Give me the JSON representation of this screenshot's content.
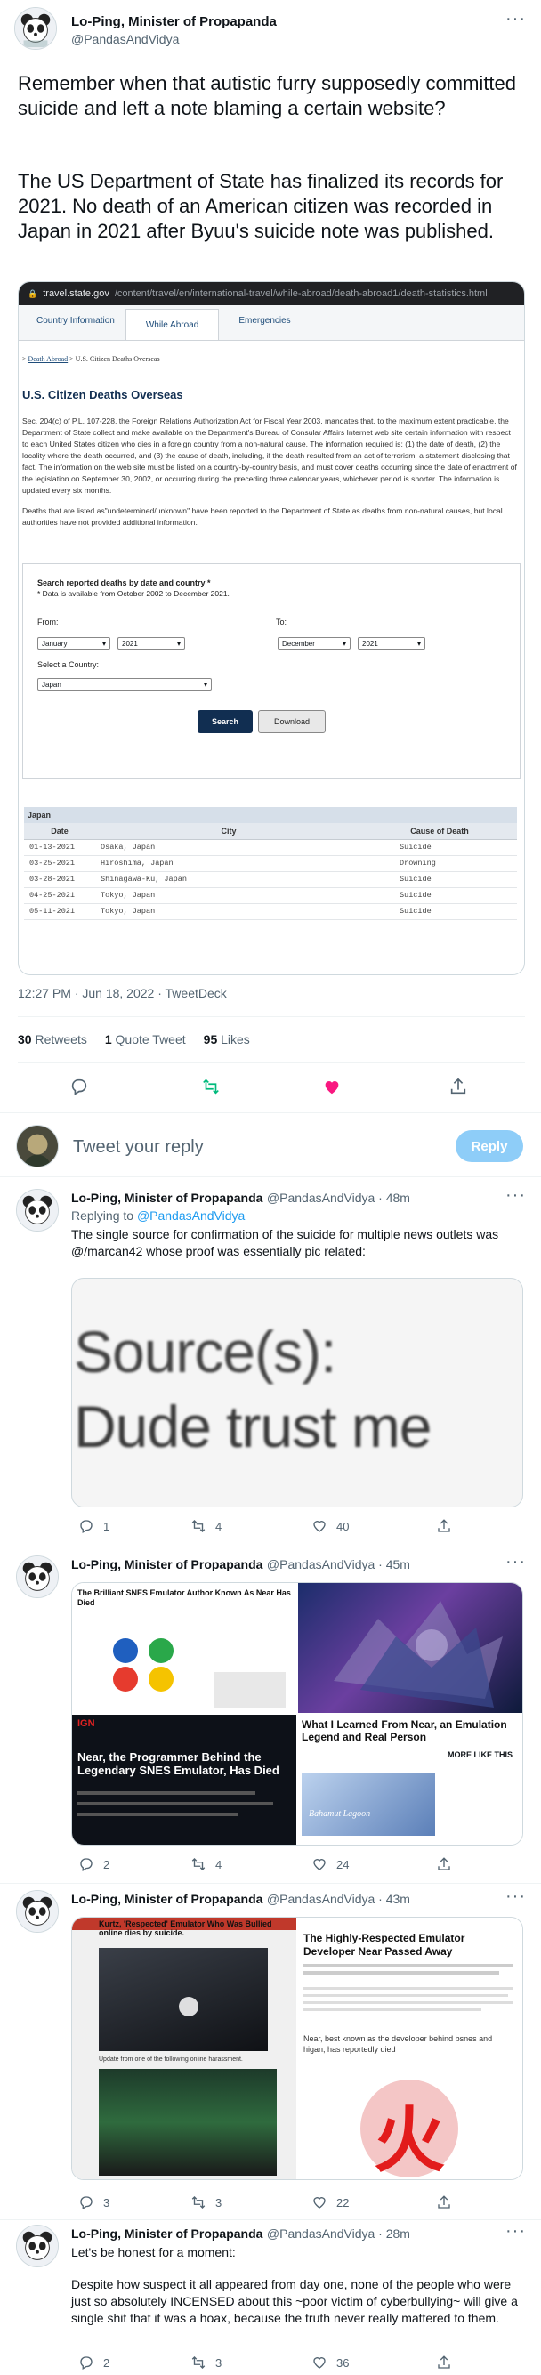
{
  "main": {
    "name": "Lo-Ping, Minister of Propapanda",
    "handle": "@PandasAndVidya",
    "text_p1": "Remember when that autistic furry supposedly committed suicide and left a note blaming a certain website?",
    "text_p2": "The US Department of State has finalized its records for 2021. No death of an American citizen was recorded in Japan in 2021 after Byuu's suicide note was published.",
    "timestamp": "12:27 PM · Jun 18, 2022 · TweetDeck",
    "stats": {
      "retweets_count": "30",
      "retweets_label": "Retweets",
      "quotes_count": "1",
      "quotes_label": "Quote Tweet",
      "likes_count": "95",
      "likes_label": "Likes"
    }
  },
  "screenshot": {
    "url_domain": "travel.state.gov",
    "url_path": "/content/travel/en/international-travel/while-abroad/death-abroad1/death-statistics.html",
    "tabs": [
      "Country Information",
      "While Abroad",
      "Emergencies"
    ],
    "breadcrumb_link": "Death Abroad",
    "breadcrumb_rest": " > U.S. Citizen Deaths Overseas",
    "heading": "U.S. Citizen Deaths Overseas",
    "para1": "Sec. 204(c) of P.L. 107-228, the Foreign Relations Authorization Act for Fiscal Year 2003, mandates that, to the maximum extent practicable, the Department of State collect and make available on the Department's Bureau of Consular Affairs Internet web site certain information with respect to each United States citizen who dies in a foreign country from a non-natural cause. The information required is: (1) the date of death, (2) the locality where the death occurred, and (3) the cause of death, including, if the death resulted from an act of terrorism, a statement disclosing that fact. The information on the web site must be listed on a country-by-country basis, and must cover deaths occurring since the date of enactment of the legislation on September 30, 2002, or occurring during the preceding three calendar years, whichever period is shorter. The information is updated every six months.",
    "para2": "Deaths that are listed as\"undetermined/unknown\" have been reported to the Department of State as deaths from non-natural causes, but local authorities have not provided additional information.",
    "form_title": "Search reported deaths by date and country *",
    "form_note": "* Data is available from October 2002 to December 2021.",
    "from_label": "From:",
    "to_label": "To:",
    "from_month": "January",
    "from_year": "2021",
    "to_month": "December",
    "to_year": "2021",
    "country_label": "Select a Country:",
    "country_value": "Japan",
    "search_btn": "Search",
    "download_btn": "Download",
    "table_country": "Japan",
    "columns": [
      "Date",
      "City",
      "Cause of Death"
    ],
    "rows": [
      [
        "01-13-2021",
        "Osaka, Japan",
        "Suicide"
      ],
      [
        "03-25-2021",
        "Hiroshima, Japan",
        "Drowning"
      ],
      [
        "03-28-2021",
        "Shinagawa-Ku, Japan",
        "Suicide"
      ],
      [
        "04-25-2021",
        "Tokyo, Japan",
        "Suicide"
      ],
      [
        "05-11-2021",
        "Tokyo, Japan",
        "Suicide"
      ]
    ]
  },
  "composer": {
    "placeholder": "Tweet your reply",
    "reply_btn": "Reply"
  },
  "replies": [
    {
      "name": "Lo-Ping, Minister of Propapanda",
      "handle": "@PandasAndVidya · 48m",
      "replying_to_label": "Replying to ",
      "replying_to_handle": "@PandasAndVidya",
      "text": "The single source for confirmation of the suicide for multiple news outlets was @/marcan42 whose proof was essentially pic related:",
      "image_line1": "Source(s):",
      "image_line2": "Dude trust me",
      "replies": "1",
      "retweets": "4",
      "likes": "40"
    },
    {
      "name": "Lo-Ping, Minister of Propapanda",
      "handle": "@PandasAndVidya · 45m",
      "img1_title": "The Brilliant SNES Emulator Author Known As Near Has Died",
      "img3_outlet": "IGN",
      "img3_title": "Near, the Programmer Behind the Legendary SNES Emulator, Has Died",
      "img4_title": "What I Learned From Near, an Emulation Legend and Real Person",
      "img4_more": "MORE LIKE THIS",
      "img4_game": "Bahamut Lagoon",
      "replies": "2",
      "retweets": "4",
      "likes": "24"
    },
    {
      "name": "Lo-Ping, Minister of Propapanda",
      "handle": "@PandasAndVidya · 43m",
      "img1_title": "Kurtz, 'Respected' Emulator Who Was Bullied online dies by suicide.",
      "img1_caption": "Update from one of the following online harassment.",
      "img2_title": "The Highly-Respected Emulator Developer Near Passed Away",
      "img2_body": "Near, best known as the developer behind bsnes and higan, has reportedly died",
      "img2_kanji": "火",
      "replies": "3",
      "retweets": "3",
      "likes": "22"
    },
    {
      "name": "Lo-Ping, Minister of Propapanda",
      "handle": "@PandasAndVidya · 28m",
      "text_p1": "Let's be honest for a moment:",
      "text_p2": "Despite how suspect it all appeared from day one, none of the people who were just so absolutely INCENSED about this ~poor victim of cyberbullying~ will give a single shit that it was a hoax, because the truth never really mattered to them.",
      "replies": "2",
      "retweets": "3",
      "likes": "36"
    }
  ],
  "colors": {
    "accent": "#1d9bf0",
    "retweet_active": "#00ba7c",
    "like_active": "#f91880",
    "dos_navy": "#112e51"
  },
  "icons": [
    "more-icon",
    "reply-icon",
    "retweet-icon",
    "like-icon",
    "share-icon",
    "panda-avatar",
    "user-avatar"
  ]
}
